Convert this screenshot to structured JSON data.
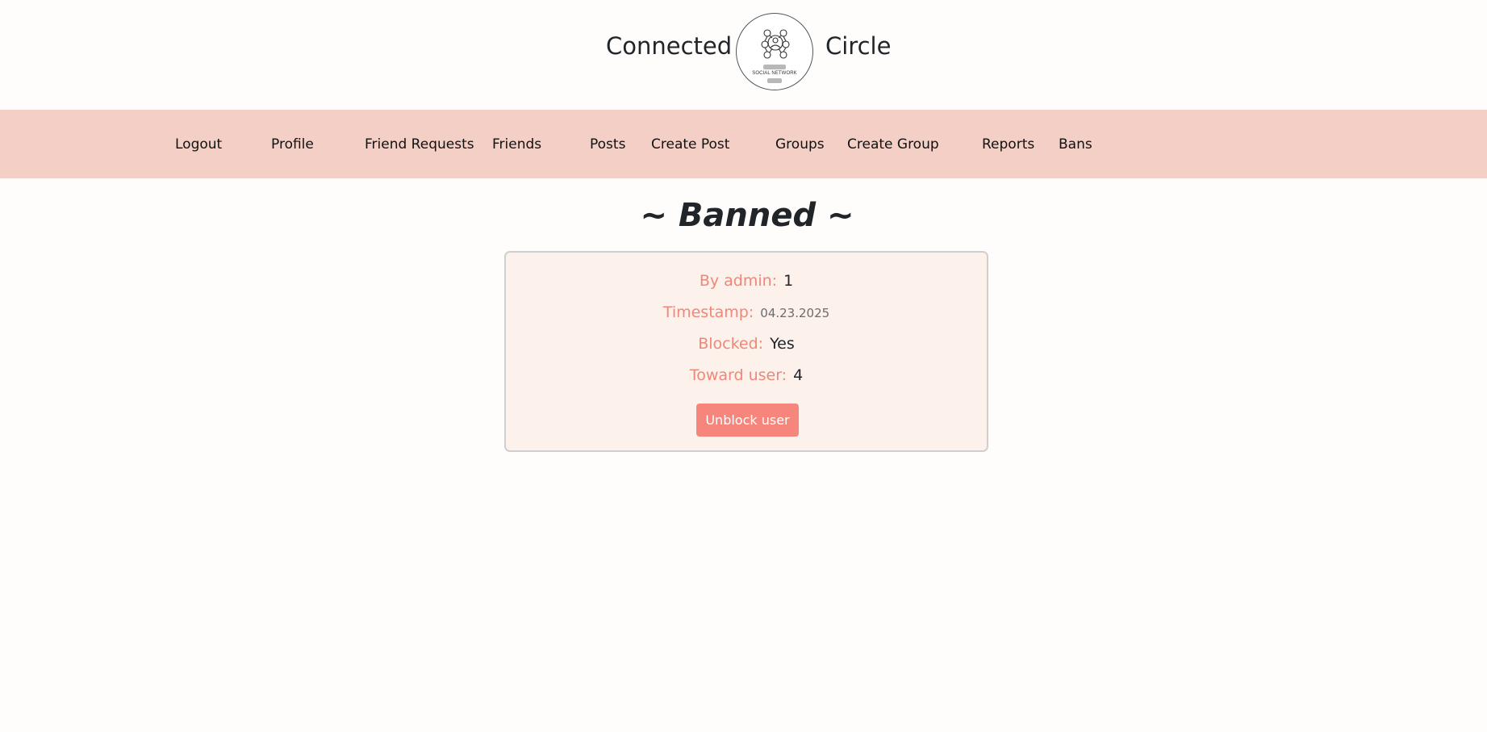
{
  "header": {
    "brand_left": "Connected",
    "brand_right": "Circle",
    "logo_caption": "SOCIAL NETWORK"
  },
  "nav": {
    "items": [
      {
        "label": "Logout"
      },
      {
        "label": "Profile"
      },
      {
        "label": "Friend Requests"
      },
      {
        "label": "Friends"
      },
      {
        "label": "Posts"
      },
      {
        "label": "Create Post"
      },
      {
        "label": "Groups"
      },
      {
        "label": "Create Group"
      },
      {
        "label": "Reports"
      },
      {
        "label": "Bans"
      }
    ]
  },
  "page": {
    "title": "~ Banned ~"
  },
  "ban": {
    "by_admin_label": "By admin:",
    "by_admin_value": "1",
    "timestamp_label": "Timestamp:",
    "timestamp_value": "04.23.2025",
    "blocked_label": "Blocked:",
    "blocked_value": "Yes",
    "toward_user_label": "Toward user:",
    "toward_user_value": "4",
    "unblock_label": "Unblock user"
  },
  "colors": {
    "nav_background": "#f3cfc6",
    "card_background": "#fdf1ec",
    "label_color": "#ef8778",
    "button_color": "#f6857b"
  }
}
